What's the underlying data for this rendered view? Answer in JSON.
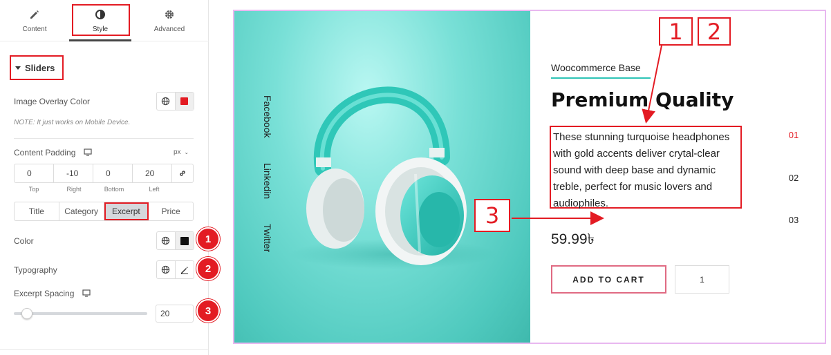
{
  "tabs": [
    {
      "label": "Content",
      "icon": "pencil-icon"
    },
    {
      "label": "Style",
      "icon": "contrast-icon"
    },
    {
      "label": "Advanced",
      "icon": "gear-icon"
    }
  ],
  "section": {
    "label": "Sliders"
  },
  "image_overlay": {
    "label": "Image Overlay Color",
    "note": "NOTE: It just works on Mobile Device.",
    "swatch": "#e31b23"
  },
  "content_padding": {
    "label": "Content Padding",
    "unit": "px",
    "values": [
      "0",
      "-10",
      "0",
      "20"
    ],
    "sides": [
      "Top",
      "Right",
      "Bottom",
      "Left"
    ]
  },
  "segments": [
    "Title",
    "Category",
    "Excerpt",
    "Price"
  ],
  "active_segment": "Excerpt",
  "color": {
    "label": "Color",
    "swatch": "#111111"
  },
  "typography": {
    "label": "Typography"
  },
  "excerpt_spacing": {
    "label": "Excerpt Spacing",
    "value": "20"
  },
  "badges": [
    "1",
    "2",
    "3"
  ],
  "preview": {
    "socials": [
      "Facebook",
      "Linkedin",
      "Twitter"
    ],
    "kicker": "Woocommerce Base",
    "title": "Premium Quality",
    "excerpt": "These stunning turquoise headphones with gold accents deliver crytal-clear sound with deep base and dynamic treble, perfect for music lovers and audiophiles.",
    "price": "59.99৳",
    "cart_label": "ADD TO CART",
    "quantity": "1",
    "pager": [
      "01",
      "02",
      "03"
    ],
    "active_page": "01"
  },
  "callouts": [
    "1",
    "2",
    "3"
  ],
  "colors": {
    "accent_red": "#e31b23",
    "teal": "#2ec4b6",
    "preview_border": "#e8b8f0"
  }
}
